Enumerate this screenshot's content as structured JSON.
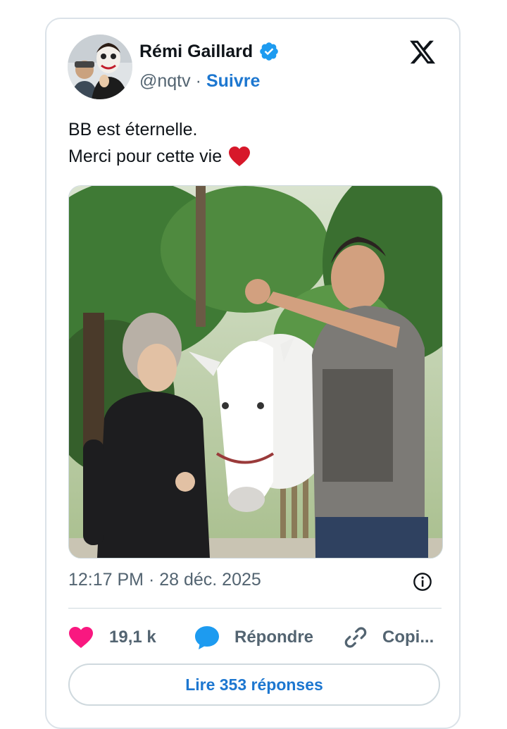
{
  "author": {
    "name": "Rémi Gaillard",
    "handle": "@nqtv",
    "separator": "·",
    "follow_label": "Suivre",
    "verified": true
  },
  "post": {
    "lines": [
      "BB est éternelle.",
      "Merci pour cette vie"
    ],
    "emoji": "red-heart",
    "timestamp": "12:17 PM · 28 déc. 2025"
  },
  "actions": {
    "likes": "19,1 k",
    "reply_label": "Répondre",
    "copy_label": "Copi..."
  },
  "footer": {
    "read_replies": "Lire 353 réponses"
  },
  "icons": [
    "x-logo-icon",
    "verified-badge-icon",
    "heart-icon",
    "speech-bubble-icon",
    "link-icon",
    "info-icon"
  ],
  "colors": {
    "accent": "#1d77d0",
    "verified": "#1d9bf0",
    "like": "#f91880",
    "text": "#0f1419",
    "muted": "#536471",
    "border": "#cfd9de"
  }
}
